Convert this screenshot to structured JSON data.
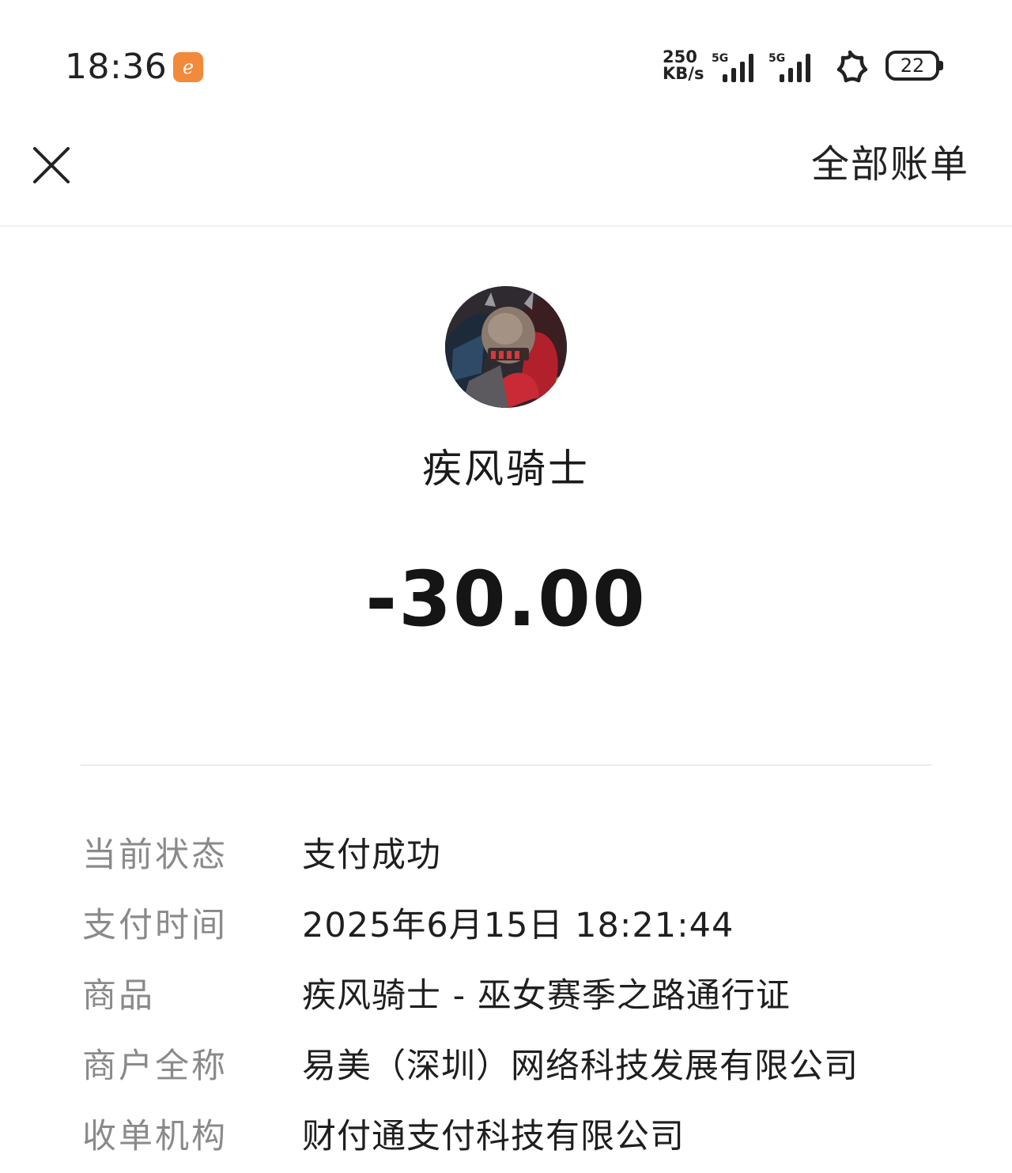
{
  "status_bar": {
    "time": "18:36",
    "app_badge_icon": "alibaba-app-icon",
    "app_badge_color": "#f28a3c",
    "net_speed_value": "250",
    "net_speed_unit": "KB/s",
    "sim1_generation": "5G",
    "sim2_generation": "5G",
    "hotspot_icon": "flower-icon",
    "battery_level": "22"
  },
  "nav": {
    "close_icon": "close-icon",
    "all_bills_label": "全部账单"
  },
  "merchant": {
    "avatar_icon": "knight-avatar",
    "name": "疾风骑士"
  },
  "amount": "-30.00",
  "details": [
    {
      "label": "当前状态",
      "value": "支付成功"
    },
    {
      "label": "支付时间",
      "value": "2025年6月15日 18:21:44"
    },
    {
      "label": "商品",
      "value": "疾风骑士 - 巫女赛季之路通行证"
    },
    {
      "label": "商户全称",
      "value": "易美（深圳）网络科技发展有限公司"
    },
    {
      "label": "收单机构",
      "value": "财付通支付科技有限公司"
    }
  ]
}
